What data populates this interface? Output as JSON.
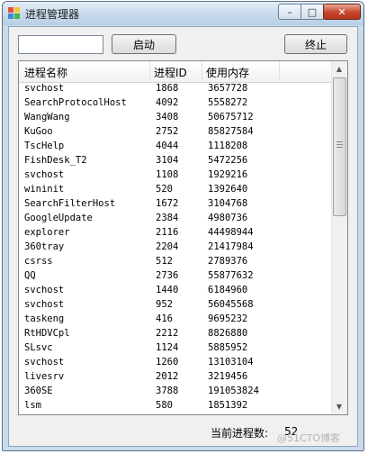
{
  "window": {
    "title": "进程管理器",
    "minimize_glyph": "–",
    "maximize_glyph": "□",
    "close_glyph": "✕"
  },
  "toolbar": {
    "search_value": "",
    "start_label": "启动",
    "stop_label": "终止"
  },
  "list": {
    "columns": [
      "进程名称",
      "进程ID",
      "使用内存"
    ],
    "rows": [
      [
        "svchost",
        "1868",
        "3657728"
      ],
      [
        "SearchProtocolHost",
        "4092",
        "5558272"
      ],
      [
        "WangWang",
        "3408",
        "50675712"
      ],
      [
        "KuGoo",
        "2752",
        "85827584"
      ],
      [
        "TscHelp",
        "4044",
        "1118208"
      ],
      [
        "FishDesk_T2",
        "3104",
        "5472256"
      ],
      [
        "svchost",
        "1108",
        "1929216"
      ],
      [
        "wininit",
        "520",
        "1392640"
      ],
      [
        "SearchFilterHost",
        "1672",
        "3104768"
      ],
      [
        "GoogleUpdate",
        "2384",
        "4980736"
      ],
      [
        "explorer",
        "2116",
        "44498944"
      ],
      [
        "360tray",
        "2204",
        "21417984"
      ],
      [
        "csrss",
        "512",
        "2789376"
      ],
      [
        "QQ",
        "2736",
        "55877632"
      ],
      [
        "svchost",
        "1440",
        "6184960"
      ],
      [
        "svchost",
        "952",
        "56045568"
      ],
      [
        "taskeng",
        "416",
        "9695232"
      ],
      [
        "RtHDVCpl",
        "2212",
        "8826880"
      ],
      [
        "SLsvc",
        "1124",
        "5885952"
      ],
      [
        "svchost",
        "1260",
        "13103104"
      ],
      [
        "livesrv",
        "2012",
        "3219456"
      ],
      [
        "360SE",
        "3788",
        "191053824"
      ],
      [
        "lsm",
        "580",
        "1851392"
      ]
    ]
  },
  "status": {
    "label": "当前进程数:",
    "count": "52"
  },
  "watermark": "@51CTO博客"
}
